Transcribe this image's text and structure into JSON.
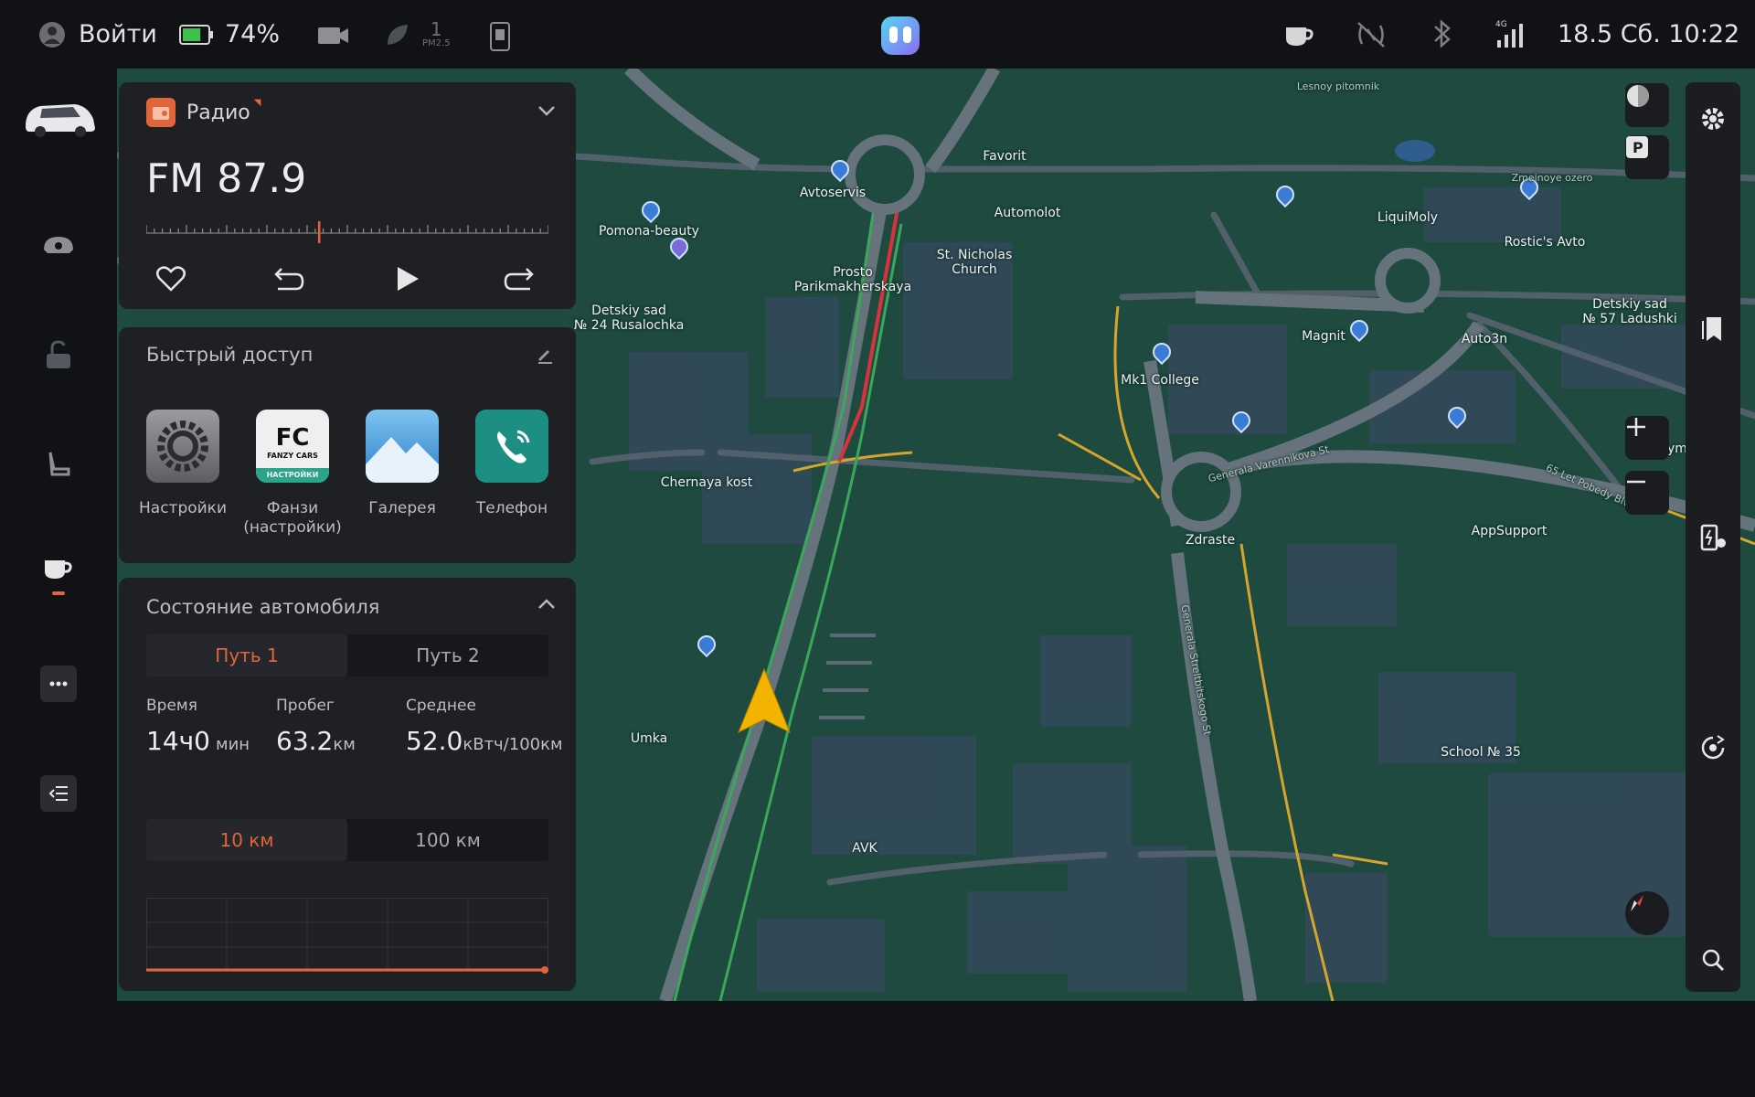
{
  "status_bar": {
    "login_label": "Войти",
    "battery_percent_label": "74%",
    "battery_level": 0.74,
    "pm25_value": "1",
    "pm25_label": "PM2.5",
    "datetime": "18.5 Сб. 10:22",
    "icons": [
      "user-icon",
      "battery-icon",
      "camera-icon",
      "leaf-icon",
      "phone-device-icon",
      "assistant-icon",
      "coffee-icon",
      "nfc-off-icon",
      "bluetooth-icon",
      "signal-4g-icon"
    ]
  },
  "left_nav": {
    "items": [
      "car-thumbnail",
      "steering-icon",
      "unlock-icon",
      "seat-icon",
      "coffee-icon",
      "more-icon",
      "collapse-list-icon"
    ]
  },
  "radio": {
    "title": "Радио",
    "frequency": "FM 87.9",
    "tuner_position": 0.43,
    "controls": [
      "heart-icon",
      "rewind-icon",
      "play-icon",
      "forward-icon"
    ]
  },
  "quick_access": {
    "title": "Быстрый доступ",
    "apps": [
      {
        "label": "Настройки",
        "icon": "settings-app-icon"
      },
      {
        "label": "Фанзи\n(настройки)",
        "icon": "fanzy-app-icon",
        "logo_text": "FC",
        "logo_sub": "FANZY CARS",
        "logo_badge": "НАСТРОЙКИ"
      },
      {
        "label": "Галерея",
        "icon": "gallery-app-icon"
      },
      {
        "label": "Телефон",
        "icon": "phone-app-icon"
      }
    ]
  },
  "car_status": {
    "title": "Состояние автомобиля",
    "trip_tabs": [
      "Путь 1",
      "Путь 2"
    ],
    "active_trip": 0,
    "stats": [
      {
        "label": "Время",
        "value": "14ч0",
        "unit": "мин"
      },
      {
        "label": "Пробег",
        "value": "63.2",
        "unit": "км"
      },
      {
        "label": "Среднее",
        "value": "52.0",
        "unit": "кВтч/100км"
      }
    ],
    "range_tabs": [
      "10 км",
      "100 км"
    ],
    "active_range": 0
  },
  "map": {
    "labels": [
      {
        "text": "Pomona-beauty"
      },
      {
        "text": "Avtoservis"
      },
      {
        "text": "Favorit"
      },
      {
        "text": "Automolot"
      },
      {
        "text": "St. Nicholas\nChurch"
      },
      {
        "text": "Prosto\nParikmakherskaya"
      },
      {
        "text": "Detskiy sad\n№ 24 Rusalochka"
      },
      {
        "text": "LiquiMoly"
      },
      {
        "text": "Rostic's Avto"
      },
      {
        "text": "Zmeinoye ozero"
      },
      {
        "text": "Detskiy sad\n№ 57 Ladushki"
      },
      {
        "text": "Magnit"
      },
      {
        "text": "Auto3n"
      },
      {
        "text": "Mk1 College"
      },
      {
        "text": "Chernaya kost"
      },
      {
        "text": "Zdraste"
      },
      {
        "text": "AppSupport"
      },
      {
        "text": "Umka"
      },
      {
        "text": "School № 35"
      },
      {
        "text": "AVK"
      },
      {
        "text": "Gymn"
      },
      {
        "text": "Lesnoy pitomnik"
      },
      {
        "text": "Generala Varennikova St"
      },
      {
        "text": "65 Let Pobedy Blvd"
      },
      {
        "text": "Generala Streltbitskogo St"
      }
    ],
    "controls": [
      "theme-toggle-icon",
      "parking-icon",
      "zoom-in-icon",
      "zoom-out-icon",
      "compass-icon"
    ]
  },
  "right_rail": {
    "items": [
      "settings-gear-icon",
      "bookmark-icon",
      "charging-station-icon",
      "recenter-icon",
      "search-icon"
    ]
  },
  "colors": {
    "accent": "#e2643a",
    "map_green": "#1e4a40",
    "road": "#4e5963",
    "route_red": "#d8333d",
    "road_yellow": "#d6a52b",
    "navigator_arrow": "#f2b400"
  }
}
